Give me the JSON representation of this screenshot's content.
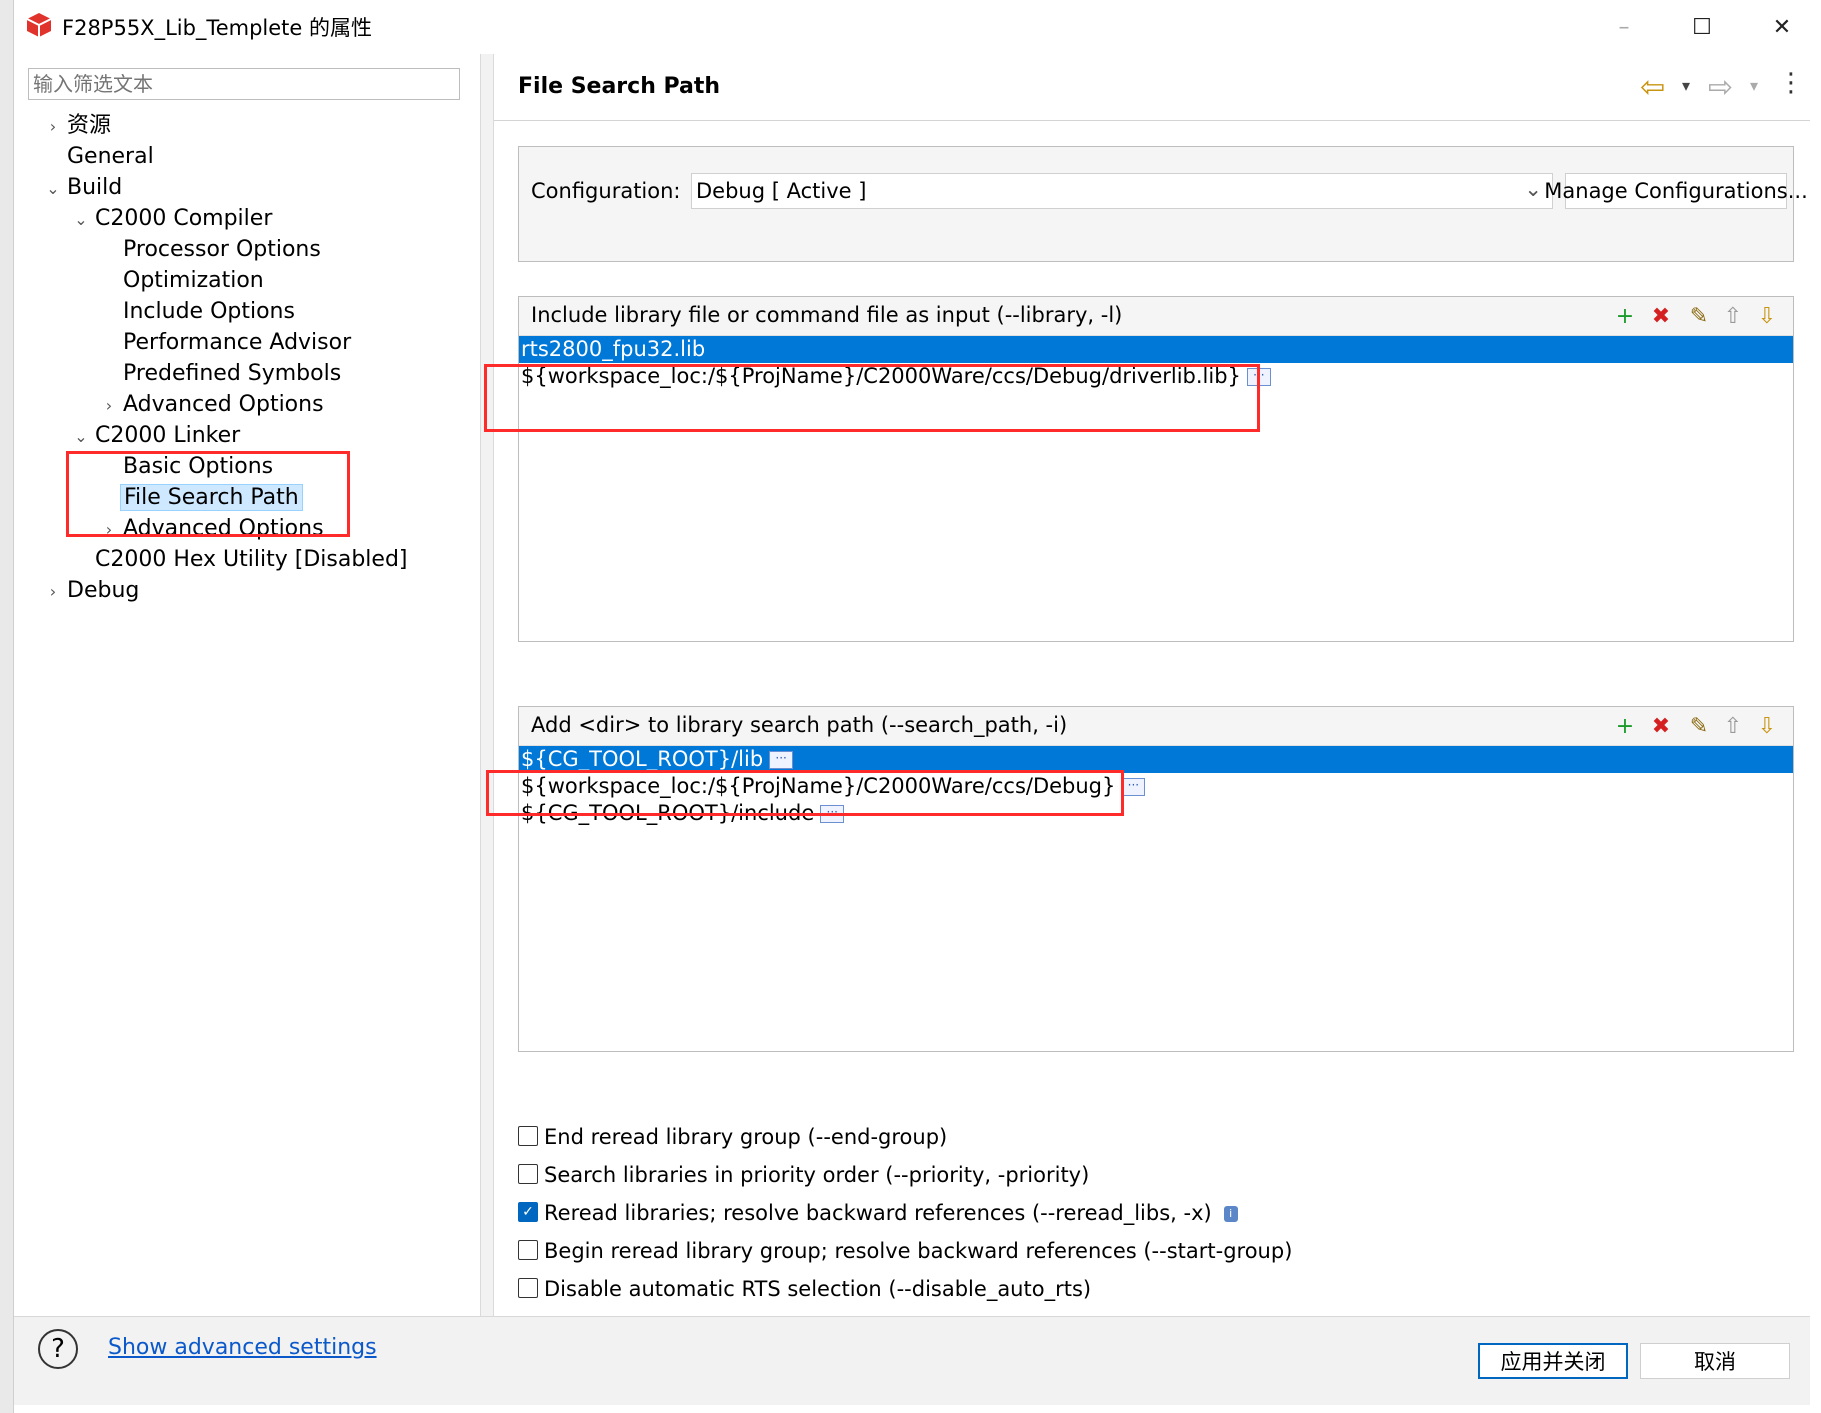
{
  "window": {
    "title": "F28P55X_Lib_Templete 的属性",
    "minimize": "–",
    "maximize": "☐",
    "close": "✕"
  },
  "sidebar": {
    "filter_placeholder": "输入筛选文本",
    "items": [
      {
        "label": "资源",
        "twisty": "›"
      },
      {
        "label": "General",
        "twisty": ""
      },
      {
        "label": "Build",
        "twisty": "⌄"
      },
      {
        "label": "C2000 Compiler",
        "twisty": "⌄"
      },
      {
        "label": "Processor Options",
        "twisty": ""
      },
      {
        "label": "Optimization",
        "twisty": ""
      },
      {
        "label": "Include Options",
        "twisty": ""
      },
      {
        "label": "Performance Advisor",
        "twisty": ""
      },
      {
        "label": "Predefined Symbols",
        "twisty": ""
      },
      {
        "label": "Advanced Options",
        "twisty": "›"
      },
      {
        "label": "C2000 Linker",
        "twisty": "⌄"
      },
      {
        "label": "Basic Options",
        "twisty": ""
      },
      {
        "label": "File Search Path",
        "twisty": ""
      },
      {
        "label": "Advanced Options",
        "twisty": "›"
      },
      {
        "label": "C2000 Hex Utility  [Disabled]",
        "twisty": ""
      },
      {
        "label": "Debug",
        "twisty": "›"
      }
    ]
  },
  "main": {
    "title": "File Search Path",
    "nav": {
      "back": "⇦",
      "forward": "⇨",
      "menu": "⋮",
      "drop": "▾"
    },
    "configuration_label": "Configuration:",
    "configuration_value": "Debug  [ Active ]",
    "configuration_arrow": "⌄",
    "manage_button": "Manage Configurations...",
    "library_list": {
      "header": "Include library file or command file as input (--library, -l)",
      "items": [
        "rts2800_fpu32.lib",
        "${workspace_loc:/${ProjName}/C2000Ware/ccs/Debug/driverlib.lib}"
      ]
    },
    "search_path_list": {
      "header": "Add <dir> to library search path (--search_path, -i)",
      "items": [
        "${CG_TOOL_ROOT}/lib",
        "${workspace_loc:/${ProjName}/C2000Ware/ccs/Debug}",
        "${CG_TOOL_ROOT}/include"
      ]
    },
    "toolbar_icons": {
      "add": "+",
      "delete": "✖",
      "edit": "✎",
      "up": "⇧",
      "down": "⇩"
    },
    "dots": "···",
    "checkboxes": [
      {
        "label": "End reread library group (--end-group)",
        "checked": false
      },
      {
        "label": "Search libraries in priority order (--priority, -priority)",
        "checked": false
      },
      {
        "label": "Reread libraries; resolve backward references (--reread_libs, -x)",
        "checked": true
      },
      {
        "label": "Begin reread library group; resolve backward references (--start-group)",
        "checked": false
      },
      {
        "label": "Disable automatic RTS selection (--disable_auto_rts)",
        "checked": false
      }
    ],
    "check_mark": "✓",
    "info_icon": "i"
  },
  "footer": {
    "help": "?",
    "advanced_link": "Show advanced settings",
    "apply_close": "应用并关闭",
    "cancel": "取消"
  }
}
